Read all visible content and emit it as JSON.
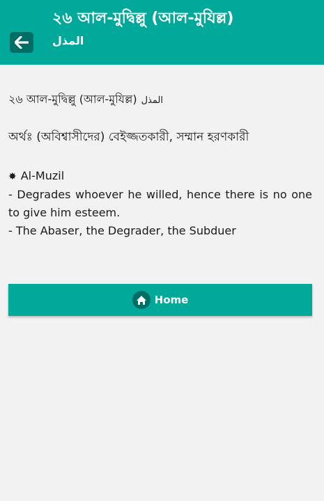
{
  "header": {
    "title": "২৬ আল-মুদ্বিল্লু (আল-মুযিল্ল)",
    "subtitle": "المذل",
    "back_icon": "arrow-left-icon"
  },
  "content": {
    "name_bn": "২৬ আল-মুদ্বিল্লু (আল-মুযিল্ল)",
    "name_ar": "المذل",
    "meaning": "অর্থঃ (অবিশ্বাসীদের) বেইজ্জতকারী, সম্মান হরণকারী",
    "star_symbol": "✸",
    "transliteration": "Al-Muzil",
    "desc_line1": "- Degrades whoever he willed, hence there is no one to give him esteem.",
    "desc_line2": "- The Abaser, the Degrader, the Subduer"
  },
  "home_button": {
    "label": "Home",
    "icon": "home-icon"
  },
  "colors": {
    "header_bg": "#00a99a",
    "button_dark": "#006e64",
    "page_bg": "#f2f2f2"
  }
}
